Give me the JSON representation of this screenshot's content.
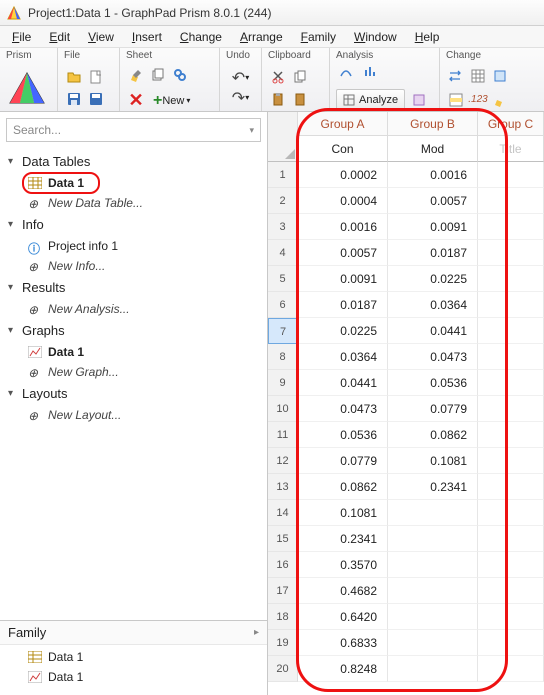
{
  "window": {
    "title": "Project1:Data 1 - GraphPad Prism 8.0.1 (244)"
  },
  "menu": [
    "File",
    "Edit",
    "View",
    "Insert",
    "Change",
    "Arrange",
    "Family",
    "Window",
    "Help"
  ],
  "ribbon": {
    "groups": {
      "prism": "Prism",
      "file": "File",
      "sheet": "Sheet",
      "undo": "Undo",
      "clipboard": "Clipboard",
      "analysis": "Analysis",
      "change": "Change"
    },
    "new_label": "New",
    "analyze_label": "Analyze"
  },
  "search": {
    "placeholder": "Search..."
  },
  "nav": {
    "sections": {
      "data_tables": "Data Tables",
      "info": "Info",
      "results": "Results",
      "graphs": "Graphs",
      "layouts": "Layouts"
    },
    "items": {
      "data1": "Data 1",
      "new_data_table": "New Data Table...",
      "project_info": "Project info 1",
      "new_info": "New Info...",
      "new_analysis": "New Analysis...",
      "graphs_data1": "Data 1",
      "new_graph": "New Graph...",
      "new_layout": "New Layout..."
    }
  },
  "family": {
    "header": "Family",
    "items": [
      "Data 1",
      "Data 1"
    ]
  },
  "table": {
    "groups": [
      "Group A",
      "Group B",
      "Group C"
    ],
    "labels": [
      "Con",
      "Mod",
      "Title"
    ],
    "rows": [
      {
        "n": 1,
        "a": "0.0002",
        "b": "0.0016"
      },
      {
        "n": 2,
        "a": "0.0004",
        "b": "0.0057"
      },
      {
        "n": 3,
        "a": "0.0016",
        "b": "0.0091"
      },
      {
        "n": 4,
        "a": "0.0057",
        "b": "0.0187"
      },
      {
        "n": 5,
        "a": "0.0091",
        "b": "0.0225"
      },
      {
        "n": 6,
        "a": "0.0187",
        "b": "0.0364"
      },
      {
        "n": 7,
        "a": "0.0225",
        "b": "0.0441"
      },
      {
        "n": 8,
        "a": "0.0364",
        "b": "0.0473"
      },
      {
        "n": 9,
        "a": "0.0441",
        "b": "0.0536"
      },
      {
        "n": 10,
        "a": "0.0473",
        "b": "0.0779"
      },
      {
        "n": 11,
        "a": "0.0536",
        "b": "0.0862"
      },
      {
        "n": 12,
        "a": "0.0779",
        "b": "0.1081"
      },
      {
        "n": 13,
        "a": "0.0862",
        "b": "0.2341"
      },
      {
        "n": 14,
        "a": "0.1081",
        "b": ""
      },
      {
        "n": 15,
        "a": "0.2341",
        "b": ""
      },
      {
        "n": 16,
        "a": "0.3570",
        "b": ""
      },
      {
        "n": 17,
        "a": "0.4682",
        "b": ""
      },
      {
        "n": 18,
        "a": "0.6420",
        "b": ""
      },
      {
        "n": 19,
        "a": "0.6833",
        "b": ""
      },
      {
        "n": 20,
        "a": "0.8248",
        "b": ""
      }
    ],
    "selected_row": 7
  }
}
